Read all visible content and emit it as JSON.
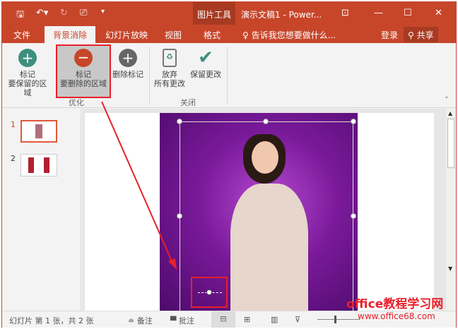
{
  "titlebar": {
    "context_tab": "图片工具",
    "title": "演示文稿1 - Power...",
    "qat": [
      "save-icon",
      "undo-icon",
      "redo-icon",
      "presenter-icon",
      "customize-icon"
    ]
  },
  "tabs": [
    {
      "label": "文件"
    },
    {
      "label": "背景消除"
    },
    {
      "label": "幻灯片放映"
    },
    {
      "label": "视图"
    },
    {
      "label": "格式"
    }
  ],
  "tell_me": "告诉我您想要做什么...",
  "login": "登录",
  "share": "共享",
  "ribbon": {
    "buttons": [
      {
        "line1": "标记",
        "line2": "要保留的区域"
      },
      {
        "line1": "标记",
        "line2": "要删除的区域"
      },
      {
        "line1": "删除标记",
        "line2": ""
      },
      {
        "line1": "放弃",
        "line2": "所有更改"
      },
      {
        "line1": "保留更改",
        "line2": ""
      }
    ],
    "groups": [
      "优化",
      "关闭"
    ]
  },
  "thumbnails": [
    {
      "number": "1"
    },
    {
      "number": "2"
    }
  ],
  "status": {
    "slide_info": "幻灯片 第 1 张，共 2 张",
    "notes": "备注",
    "comments": "批注"
  },
  "watermark": {
    "line1": "office教程学习网",
    "line2": "www.office68.com"
  },
  "colors": {
    "accent": "#c7462a",
    "highlight": "#e8202a"
  }
}
